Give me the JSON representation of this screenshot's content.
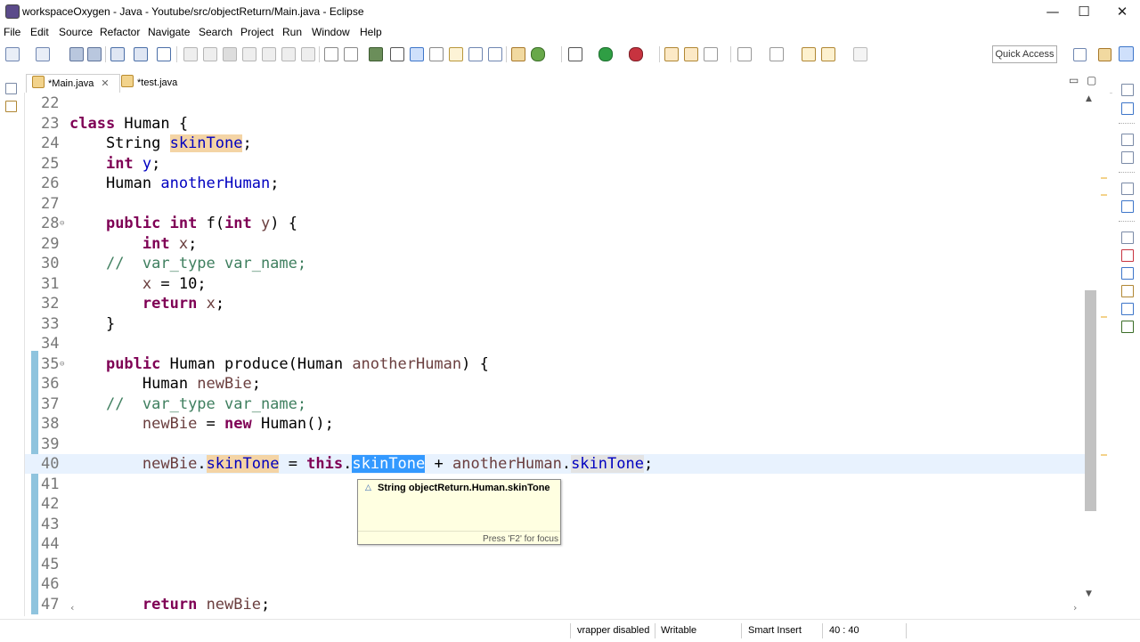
{
  "window": {
    "title": "workspaceOxygen - Java - Youtube/src/objectReturn/Main.java - Eclipse",
    "minimize_glyph": "—",
    "maximize_glyph": "☐",
    "close_glyph": "✕"
  },
  "menu": [
    "File",
    "Edit",
    "Source",
    "Refactor",
    "Navigate",
    "Search",
    "Project",
    "Run",
    "Window",
    "Help"
  ],
  "toolbar": {
    "quick_access": "Quick Access"
  },
  "tabs": [
    {
      "label": "*Main.java",
      "active": true,
      "close": "✕"
    },
    {
      "label": "*test.java",
      "active": false
    }
  ],
  "tab_controls": {
    "minimize": "▭",
    "maximize": "▢"
  },
  "editor": {
    "current_line": 40,
    "lines": [
      {
        "no": "22",
        "html": ""
      },
      {
        "no": "23",
        "html": "<span class=\"kw\">class</span> Human {"
      },
      {
        "no": "24",
        "html": "    String <span class=\"fld occ\">skinTone</span>;"
      },
      {
        "no": "25",
        "html": "    <span class=\"kw\">int</span> <span class=\"fld\">y</span>;"
      },
      {
        "no": "26",
        "html": "    Human <span class=\"fld\">anotherHuman</span>;"
      },
      {
        "no": "27",
        "html": ""
      },
      {
        "no": "28",
        "fold": "⊖",
        "html": "    <span class=\"kw\">public</span> <span class=\"kw\">int</span> f(<span class=\"kw\">int</span> <span class=\"var\">y</span>) {"
      },
      {
        "no": "29",
        "html": "        <span class=\"kw\">int</span> <span class=\"var\">x</span>;"
      },
      {
        "no": "30",
        "html": "    <span class=\"cmt\">//  var_type var_name;</span>"
      },
      {
        "no": "31",
        "html": "        <span class=\"var\">x</span> = 10;"
      },
      {
        "no": "32",
        "html": "        <span class=\"kw\">return</span> <span class=\"var\">x</span>;"
      },
      {
        "no": "33",
        "html": "    }"
      },
      {
        "no": "34",
        "html": ""
      },
      {
        "no": "35",
        "fold": "⊖",
        "html": "    <span class=\"kw\">public</span> Human produce(Human <span class=\"var\">anotherHuman</span>) {"
      },
      {
        "no": "36",
        "html": "        Human <span class=\"var\">newBie</span>;"
      },
      {
        "no": "37",
        "html": "    <span class=\"cmt\">//  var_type var_name;</span>"
      },
      {
        "no": "38",
        "html": "        <span class=\"var\">newBie</span> = <span class=\"kw\">new</span> Human();"
      },
      {
        "no": "39",
        "html": ""
      },
      {
        "no": "40",
        "html": "        <span class=\"var\">newBie</span>.<span class=\"fld occ\">skinTone</span> = <span class=\"kw\">this</span>.<span class=\"sel\">skinTone</span> + <span class=\"var\">anotherHuman</span>.<span class=\"occ2\">skinTone</span>;"
      },
      {
        "no": "41",
        "html": ""
      },
      {
        "no": "42",
        "html": ""
      },
      {
        "no": "43",
        "html": ""
      },
      {
        "no": "44",
        "html": ""
      },
      {
        "no": "45",
        "html": ""
      },
      {
        "no": "46",
        "html": ""
      },
      {
        "no": "47",
        "html": "        <span class=\"kw\">return</span> <span class=\"var\">newBie</span>;"
      }
    ]
  },
  "hover": {
    "signature": "String objectReturn.Human.skinTone",
    "hint": "Press 'F2' for focus"
  },
  "statusbar": {
    "vrapper": "vrapper disabled",
    "mode": "Writable",
    "insert": "Smart Insert",
    "position": "40 : 40"
  }
}
